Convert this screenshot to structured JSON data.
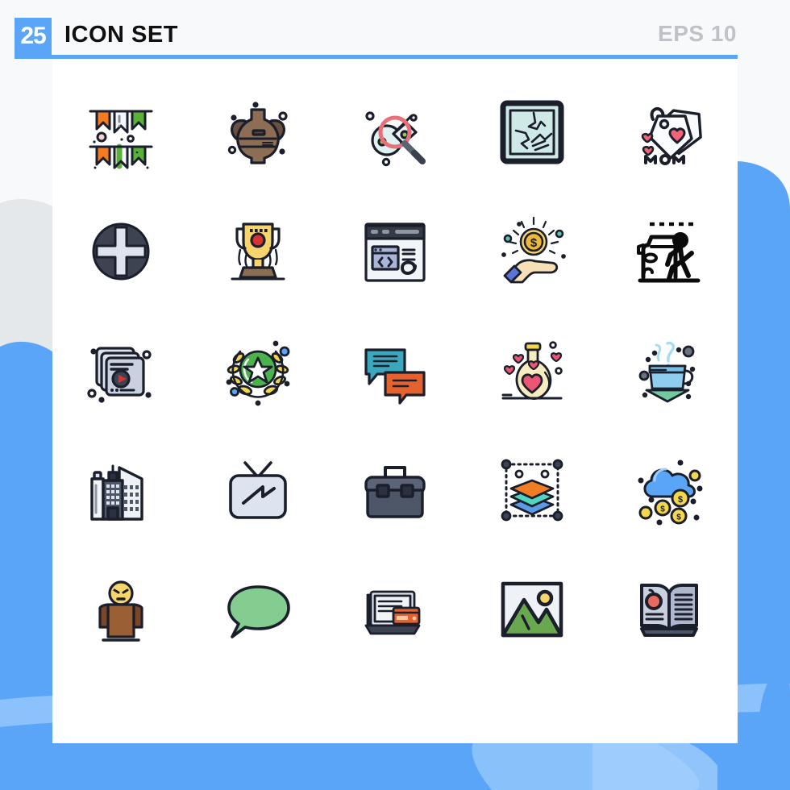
{
  "header": {
    "count": "25",
    "title": "ICON SET",
    "eps_label": "EPS 10",
    "badge_color": "#5aa5f7",
    "rule_color": "#5aa5f7",
    "title_color": "#101010",
    "eps_color": "#bfc3c7"
  },
  "page": {
    "background_color": "#f7f9fb",
    "card_color": "#ffffff",
    "blob_blue": "#5aa5f7",
    "blob_blue_light": "#8cc2fb",
    "blob_gray": "#e4e8eb"
  },
  "grid": {
    "columns": 5,
    "rows": 5,
    "total_icons": 25
  },
  "icons": [
    {
      "index": 1,
      "name": "bunting-flags-icon",
      "label": "Bunting Flags",
      "row": 1,
      "col": 1
    },
    {
      "index": 2,
      "name": "clay-vase-icon",
      "label": "Clay Vase",
      "row": 1,
      "col": 2
    },
    {
      "index": 3,
      "name": "search-flag-icon",
      "label": "Search Flag",
      "row": 1,
      "col": 3
    },
    {
      "index": 4,
      "name": "broken-window-icon",
      "label": "Broken Window",
      "row": 1,
      "col": 4
    },
    {
      "index": 5,
      "name": "mom-gift-tags-icon",
      "label": "Mom Gift Tags",
      "row": 1,
      "col": 5
    },
    {
      "index": 6,
      "name": "screw-head-icon",
      "label": "Screw Head",
      "row": 2,
      "col": 1
    },
    {
      "index": 7,
      "name": "trophy-icon",
      "label": "Trophy",
      "row": 2,
      "col": 2
    },
    {
      "index": 8,
      "name": "code-browser-icon",
      "label": "Code Browser",
      "row": 2,
      "col": 3
    },
    {
      "index": 9,
      "name": "hand-coin-icon",
      "label": "Hand With Coin",
      "row": 2,
      "col": 4
    },
    {
      "index": 10,
      "name": "pedestrian-crossing-icon",
      "label": "Pedestrian Crossing",
      "row": 2,
      "col": 5
    },
    {
      "index": 11,
      "name": "video-gallery-icon",
      "label": "Video Gallery",
      "row": 3,
      "col": 1
    },
    {
      "index": 12,
      "name": "laurel-star-badge-icon",
      "label": "Laurel Star Badge",
      "row": 3,
      "col": 2
    },
    {
      "index": 13,
      "name": "chat-bubbles-icon",
      "label": "Chat Bubbles",
      "row": 3,
      "col": 3
    },
    {
      "index": 14,
      "name": "love-potion-flask-icon",
      "label": "Love Potion Flask",
      "row": 3,
      "col": 4
    },
    {
      "index": 15,
      "name": "tea-cup-icon",
      "label": "Tea Cup",
      "row": 3,
      "col": 5
    },
    {
      "index": 16,
      "name": "city-buildings-icon",
      "label": "City Buildings",
      "row": 4,
      "col": 1
    },
    {
      "index": 17,
      "name": "television-icon",
      "label": "Television",
      "row": 4,
      "col": 2
    },
    {
      "index": 18,
      "name": "toolbox-icon",
      "label": "Toolbox",
      "row": 4,
      "col": 3
    },
    {
      "index": 19,
      "name": "layers-icon",
      "label": "Layers",
      "row": 4,
      "col": 4
    },
    {
      "index": 20,
      "name": "cloud-money-icon",
      "label": "Cloud Money",
      "row": 4,
      "col": 5
    },
    {
      "index": 21,
      "name": "sad-person-icon",
      "label": "Sad Person",
      "row": 5,
      "col": 1
    },
    {
      "index": 22,
      "name": "speech-bubble-icon",
      "label": "Speech Bubble",
      "row": 5,
      "col": 2
    },
    {
      "index": 23,
      "name": "laptop-card-payment-icon",
      "label": "Laptop Card Payment",
      "row": 5,
      "col": 3
    },
    {
      "index": 24,
      "name": "image-photo-icon",
      "label": "Image Photo",
      "row": 5,
      "col": 4
    },
    {
      "index": 25,
      "name": "open-book-apple-icon",
      "label": "Open Book Apple",
      "row": 5,
      "col": 5
    }
  ],
  "palette": {
    "outline": "#1a1f2b",
    "orange": "#f47b20",
    "green": "#5bb037",
    "red": "#e8505b",
    "pink": "#f28b9b",
    "yellow": "#f6d64a",
    "mint": "#cfeae6",
    "lavender": "#ccd2e8",
    "brown": "#8d6e55",
    "teal": "#2fb4c4",
    "slate": "#4d5768",
    "sky": "#5aa5f7"
  }
}
